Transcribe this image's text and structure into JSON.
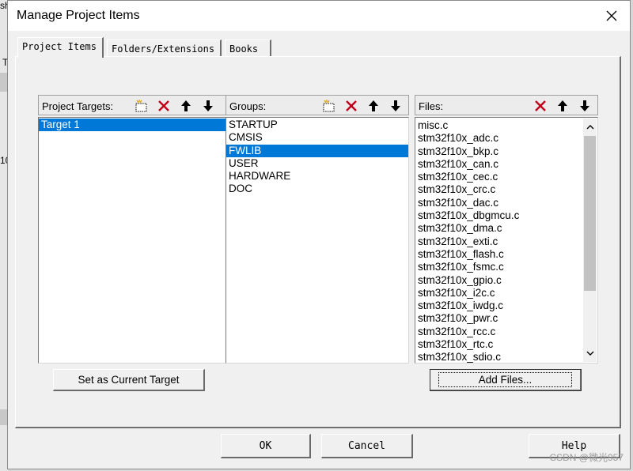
{
  "window": {
    "title": "Manage Project Items"
  },
  "background": {
    "text1": "sh",
    "text2": "T",
    "text3": "10"
  },
  "tabs": [
    {
      "label": "Project Items"
    },
    {
      "label": "Folders/Extensions"
    },
    {
      "label": "Books"
    }
  ],
  "targets": {
    "header": "Project Targets:",
    "items": [
      "Target 1"
    ]
  },
  "groups": {
    "header": "Groups:",
    "items": [
      "STARTUP",
      "CMSIS",
      "FWLIB",
      "USER",
      "HARDWARE",
      "DOC"
    ]
  },
  "files": {
    "header": "Files:",
    "items": [
      "misc.c",
      "stm32f10x_adc.c",
      "stm32f10x_bkp.c",
      "stm32f10x_can.c",
      "stm32f10x_cec.c",
      "stm32f10x_crc.c",
      "stm32f10x_dac.c",
      "stm32f10x_dbgmcu.c",
      "stm32f10x_dma.c",
      "stm32f10x_exti.c",
      "stm32f10x_flash.c",
      "stm32f10x_fsmc.c",
      "stm32f10x_gpio.c",
      "stm32f10x_i2c.c",
      "stm32f10x_iwdg.c",
      "stm32f10x_pwr.c",
      "stm32f10x_rcc.c",
      "stm32f10x_rtc.c",
      "stm32f10x_sdio.c"
    ]
  },
  "buttons": {
    "set_target": "Set as Current Target",
    "add_files": "Add Files...",
    "ok": "OK",
    "cancel": "Cancel",
    "help": "Help"
  },
  "watermark": "CSDN @微光957",
  "colors": {
    "selection": "#0078d7",
    "delete_icon": "#c0001a"
  }
}
